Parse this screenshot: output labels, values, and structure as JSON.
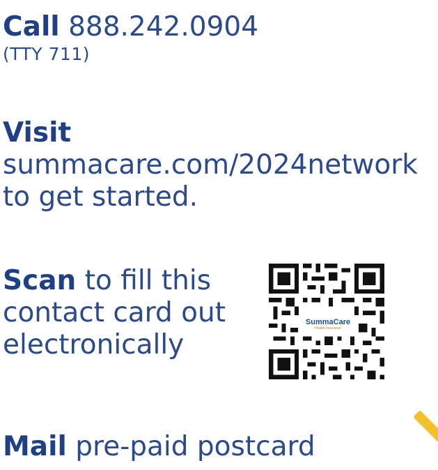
{
  "call": {
    "label": "Call",
    "number": "888.242.0904",
    "tty": "(TTY 711)"
  },
  "visit": {
    "label": "Visit",
    "url": "summacare.com/2024network",
    "tail": "to get started."
  },
  "scan": {
    "label": "Scan",
    "line1_rest": "to fill this",
    "line2": "contact card out",
    "line3": "electronically"
  },
  "qr": {
    "brand": "SummaCare",
    "sub": "Health Insurance"
  },
  "mail": {
    "label": "Mail",
    "rest": "pre-paid postcard"
  },
  "colors": {
    "text": "#2a4a8c",
    "strong": "#1f3f86",
    "accent": "#f3c12a",
    "qr_dark": "#111111"
  }
}
